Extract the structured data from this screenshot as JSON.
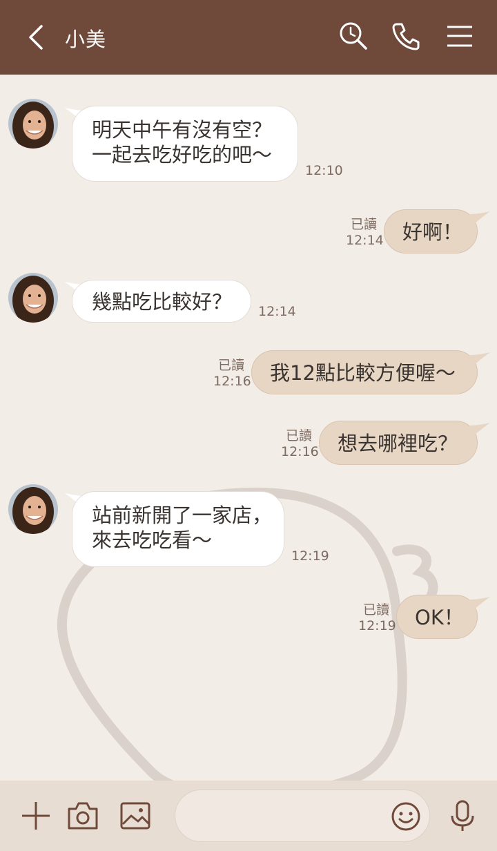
{
  "header": {
    "title": "小美"
  },
  "messages": [
    {
      "dir": "in",
      "lines": [
        "明天中午有沒有空？",
        "一起去吃好吃的吧～"
      ],
      "time": "12:10"
    },
    {
      "dir": "out",
      "text": "好啊！",
      "read": "已讀",
      "time": "12:14"
    },
    {
      "dir": "in",
      "lines": [
        "幾點吃比較好？"
      ],
      "time": "12:14"
    },
    {
      "dir": "out",
      "text": "我12點比較方便喔～",
      "read": "已讀",
      "time": "12:16"
    },
    {
      "dir": "out",
      "text": "想去哪裡吃？",
      "read": "已讀",
      "time": "12:16"
    },
    {
      "dir": "in",
      "lines": [
        "站前新開了一家店，",
        "來去吃吃看～"
      ],
      "time": "12:19"
    },
    {
      "dir": "out",
      "text": "OK！",
      "read": "已讀",
      "time": "12:19"
    }
  ],
  "input": {
    "placeholder": ""
  },
  "icons": {
    "back": "chevron-left-icon",
    "search": "search-icon",
    "call": "phone-icon",
    "menu": "menu-icon",
    "add": "plus-icon",
    "camera": "camera-icon",
    "image": "image-icon",
    "emoji": "smiley-icon",
    "mic": "microphone-icon"
  },
  "colors": {
    "header": "#6f4a3b",
    "background": "#f2ede7",
    "outgoing_bubble": "#e8d6c4",
    "incoming_bubble": "#ffffff"
  }
}
